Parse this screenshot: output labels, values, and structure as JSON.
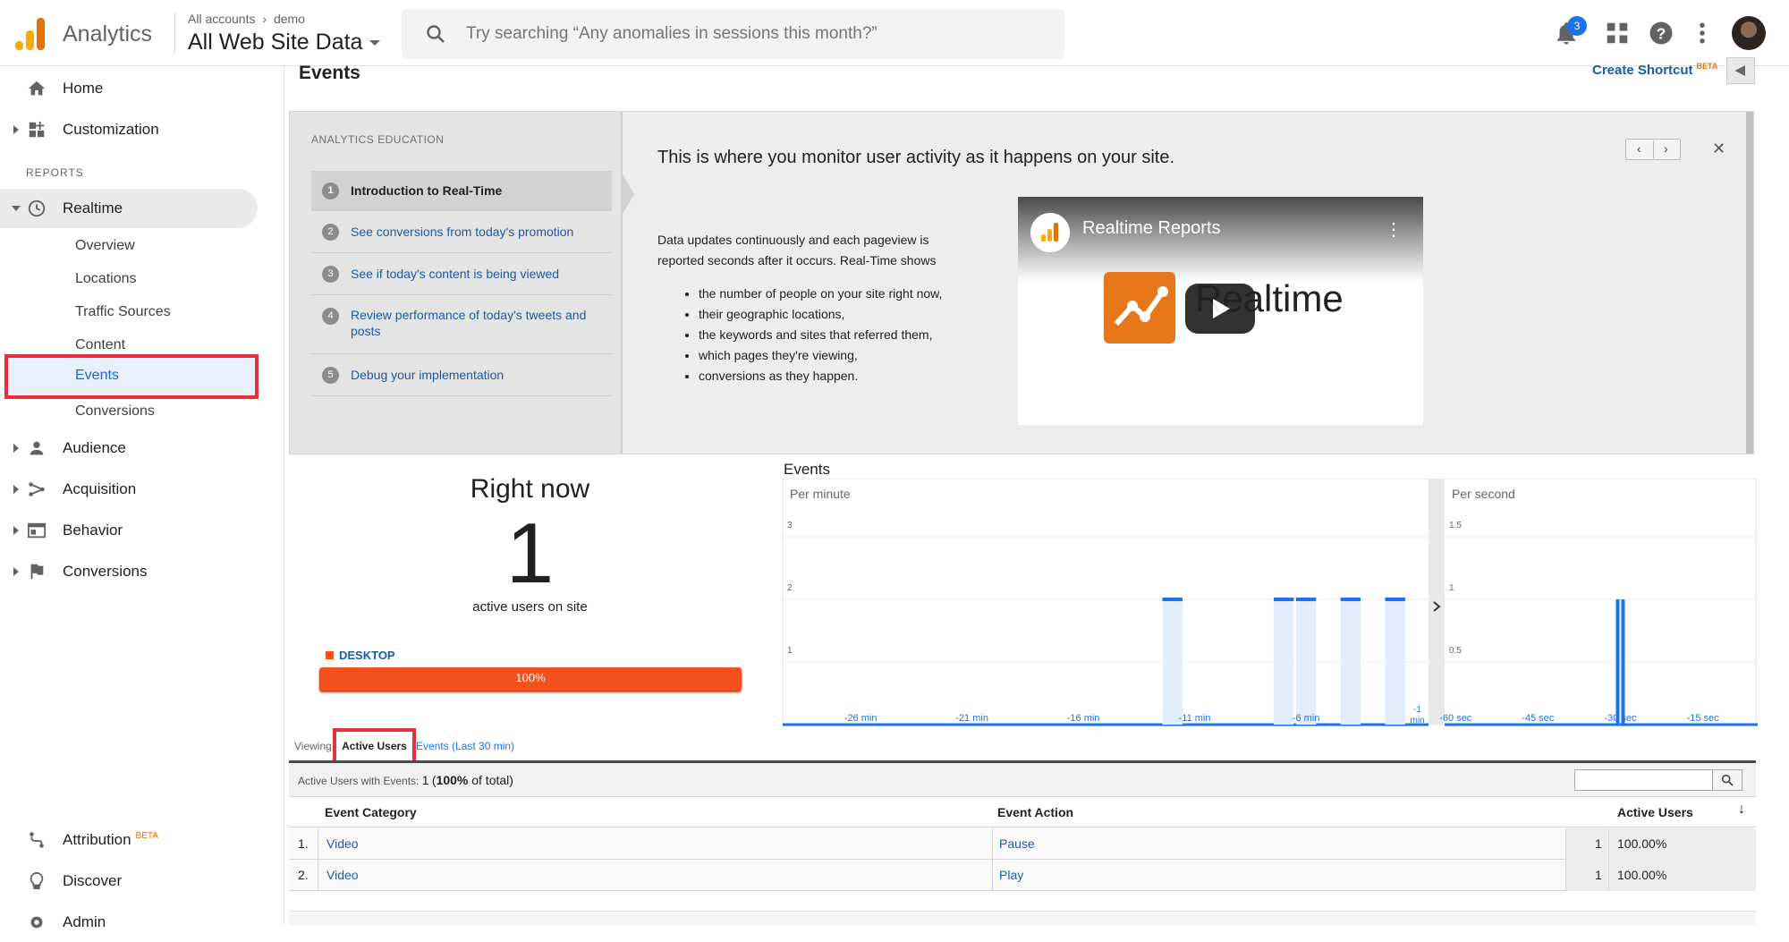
{
  "header": {
    "product": "Analytics",
    "breadcrumb_root": "All accounts",
    "breadcrumb_chevron": "›",
    "breadcrumb_account": "demo",
    "property": "All Web Site Data",
    "search_placeholder": "Try searching “Any anomalies in sessions this month?”",
    "notification_count": "3"
  },
  "sidebar": {
    "home": "Home",
    "customization": "Customization",
    "reports_section": "REPORTS",
    "realtime": "Realtime",
    "realtime_items": [
      "Overview",
      "Locations",
      "Traffic Sources",
      "Content",
      "Events",
      "Conversions"
    ],
    "audience": "Audience",
    "acquisition": "Acquisition",
    "behavior": "Behavior",
    "conversions": "Conversions",
    "attribution": "Attribution",
    "attribution_badge": "BETA",
    "discover": "Discover",
    "admin": "Admin"
  },
  "page": {
    "title": "Events",
    "create_shortcut": "Create Shortcut",
    "create_shortcut_badge": "BETA"
  },
  "education": {
    "heading": "ANALYTICS EDUCATION",
    "steps": [
      {
        "num": "1",
        "text": "Introduction to Real-Time"
      },
      {
        "num": "2",
        "text": "See conversions from today's promotion"
      },
      {
        "num": "3",
        "text": "See if today's content is being viewed"
      },
      {
        "num": "4",
        "text": "Review performance of today's tweets and posts"
      },
      {
        "num": "5",
        "text": "Debug your implementation"
      }
    ],
    "title": "This is where you monitor user activity as it happens on your site.",
    "body": "Data updates continuously and each pageview is reported seconds after it occurs. Real-Time shows",
    "bullets": [
      "the number of people on your site right now,",
      "their geographic locations,",
      "the keywords and sites that referred them,",
      "which pages they're viewing,",
      "conversions as they happen."
    ],
    "video_title": "Realtime Reports",
    "video_big_text": "Realtime",
    "prev": "‹",
    "next": "›",
    "close": "✕"
  },
  "right_now": {
    "title": "Right now",
    "count": "1",
    "subtitle": "active users on site",
    "device": "DESKTOP",
    "device_share": "100%"
  },
  "chart_data": [
    {
      "type": "bar",
      "title": "Events",
      "subtitle": "Per minute",
      "x": [
        -29,
        -28,
        -27,
        -26,
        -25,
        -24,
        -23,
        -22,
        -21,
        -20,
        -19,
        -18,
        -17,
        -16,
        -15,
        -14,
        -13,
        -12,
        -11,
        -10,
        -9,
        -8,
        -7,
        -6,
        -5,
        -4,
        -3,
        -2,
        -1
      ],
      "values": [
        0,
        0,
        0,
        0,
        0,
        0,
        0,
        0,
        0,
        0,
        0,
        0,
        0,
        0,
        0,
        0,
        0,
        2,
        0,
        0,
        0,
        0,
        2,
        2,
        0,
        2,
        0,
        2,
        0
      ],
      "x_ticks": [
        "-26 min",
        "-21 min",
        "-16 min",
        "-11 min",
        "-6 min",
        "-1 min"
      ],
      "y_ticks": [
        "1",
        "2",
        "3"
      ],
      "ylim": [
        0,
        3.5
      ]
    },
    {
      "type": "bar",
      "subtitle": "Per second",
      "x": [
        -60,
        -45,
        -30,
        -15
      ],
      "values": [
        0,
        0,
        1,
        0
      ],
      "x_ticks": [
        "-60 sec",
        "-45 sec",
        "-30 sec",
        "-15 sec"
      ],
      "y_ticks": [
        "0.5",
        "1",
        "1.5"
      ],
      "ylim": [
        0,
        1.75
      ]
    }
  ],
  "viewing": {
    "label": "Viewing:",
    "active_tab": "Active Users",
    "other_tab": "Events (Last 30 min)"
  },
  "table": {
    "summary_label": "Active Users with Events:",
    "summary_value": "1",
    "summary_pct": "100%",
    "summary_suffix": "of total",
    "headers": [
      "Event Category",
      "Event Action",
      "Active Users"
    ],
    "rows": [
      {
        "index": "1.",
        "category": "Video",
        "action": "Pause",
        "users": "1",
        "pct": "100.00%"
      },
      {
        "index": "2.",
        "category": "Video",
        "action": "Play",
        "users": "1",
        "pct": "100.00%"
      }
    ]
  },
  "colors": {
    "accent": "#1a73e8",
    "link": "#1a5ba8",
    "desktop_bar": "#f4511e",
    "highlight": "#e53238",
    "chart_bar": "#1a73e8"
  }
}
